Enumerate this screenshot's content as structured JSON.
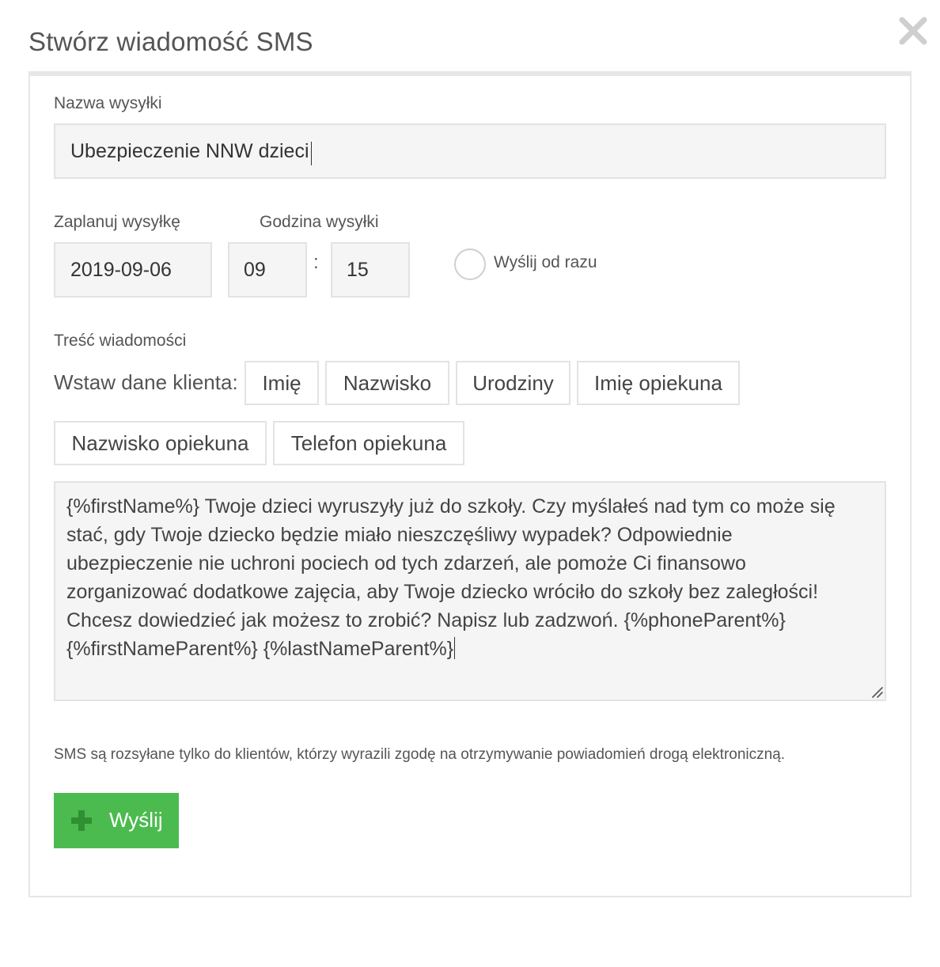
{
  "dialog": {
    "title": "Stwórz wiadomość SMS",
    "close_icon": "close-icon"
  },
  "form": {
    "name_label": "Nazwa wysyłki",
    "name_value": "Ubezpieczenie NNW dzieci",
    "schedule_label": "Zaplanuj wysyłkę",
    "time_label": "Godzina wysyłki",
    "date_value": "2019-09-06",
    "hour_value": "09",
    "time_separator": ":",
    "minute_value": "15",
    "send_now_label": "Wyślij od razu",
    "send_now_checked": false,
    "content_label": "Treść wiadomości",
    "insert_label": "Wstaw dane klienta:",
    "insert_buttons": [
      "Imię",
      "Nazwisko",
      "Urodziny",
      "Imię opiekuna",
      "Nazwisko opiekuna",
      "Telefon opiekuna"
    ],
    "message_lines": [
      "{%firstName%} Twoje dzieci wyruszyły już do szkoły. Czy myślałeś nad tym co może się",
      "stać, gdy Twoje dziecko będzie miało nieszczęśliwy wypadek? Odpowiednie",
      "ubezpieczenie nie uchroni pociech od tych zdarzeń, ale pomoże Ci finansowo",
      "zorganizować dodatkowe zajęcia, aby Twoje dziecko wróciło do szkoły bez zaległości!",
      "Chcesz dowiedzieć jak możesz to zrobić? Napisz lub zadzwoń. {%phoneParent%}",
      "{%firstNameParent%} {%lastNameParent%}"
    ],
    "consent_note": "SMS są rozsyłane tylko do klientów, którzy wyrazili zgodę na otrzymywanie powiadomień drogą elektroniczną.",
    "send_label": "Wyślij",
    "send_icon": "plus-icon"
  },
  "colors": {
    "accent": "#4cbb4f",
    "field_bg": "#f5f5f5",
    "border": "#e3e3e3"
  }
}
